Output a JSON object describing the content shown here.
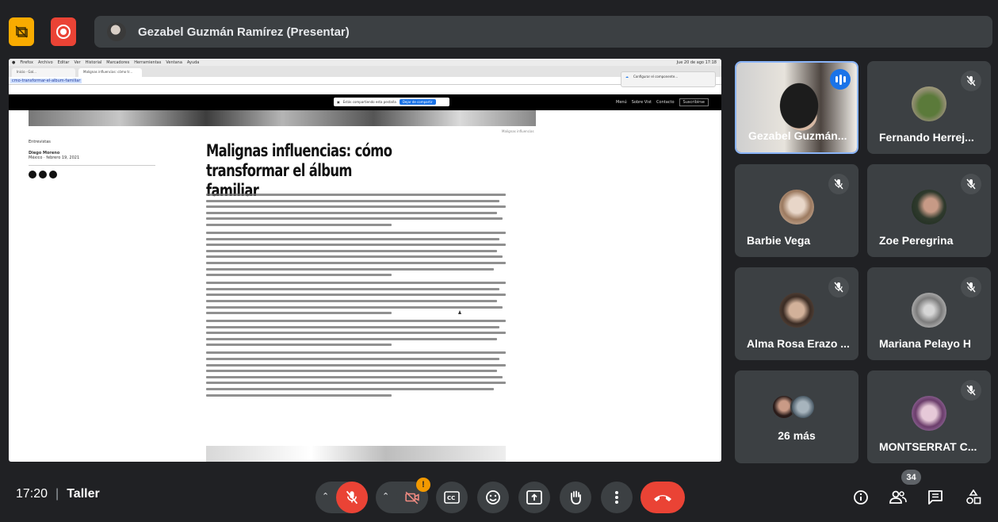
{
  "top_bar": {
    "presenter_label": "Gezabel Guzmán Ramírez (Presentar)",
    "icons": [
      "no-video-stack-icon",
      "record-icon"
    ]
  },
  "shared_screen": {
    "browser_menu": [
      "Firefox",
      "Archivo",
      "Editar",
      "Ver",
      "Historial",
      "Marcadores",
      "Herramientas",
      "Ventana",
      "Ayuda"
    ],
    "menu_right": "Jue 20 de ago 17:18",
    "tabs": [
      "Inicio · Gal...",
      "Malignas influencias: cómo tr..."
    ],
    "url": "cmo-transformar-el-album-familiar",
    "notification_text": "Configurar el componente...",
    "share_banner_text": "Estás compartiendo esta pestaña",
    "share_banner_button": "Dejar de compartir",
    "site_nav": [
      "Menú",
      "Sobre Vist",
      "Contacto",
      "Suscribirse"
    ],
    "caption": "Malignas influencias",
    "category": "Entrevistas",
    "author": "Diego Moreno",
    "dateline": "México · febrero 19, 2021",
    "article_title": "Malignas influencias: cómo transformar el álbum familiar",
    "paragraph_line_counts": [
      6,
      8,
      6,
      5,
      8
    ]
  },
  "participants": [
    {
      "name": "Gezabel Guzmán...",
      "speaking": true
    },
    {
      "name": "Fernando Herrej...",
      "muted": true
    },
    {
      "name": "Barbie Vega",
      "muted": true
    },
    {
      "name": "Zoe Peregrina",
      "muted": true
    },
    {
      "name": "Alma Rosa Erazo ...",
      "muted": true
    },
    {
      "name": "Mariana Pelayo H",
      "muted": true
    },
    {
      "name": "26 más"
    },
    {
      "name": "MONTSERRAT C...",
      "muted": true
    }
  ],
  "bottom_bar": {
    "time": "17:20",
    "separator": "|",
    "meeting_name": "Taller",
    "camera_badge": "!",
    "people_count": "34"
  },
  "colors": {
    "background": "#202124",
    "tile": "#3c4043",
    "danger": "#ea4335",
    "accent": "#1a73e8",
    "warning": "#f9ab00"
  }
}
